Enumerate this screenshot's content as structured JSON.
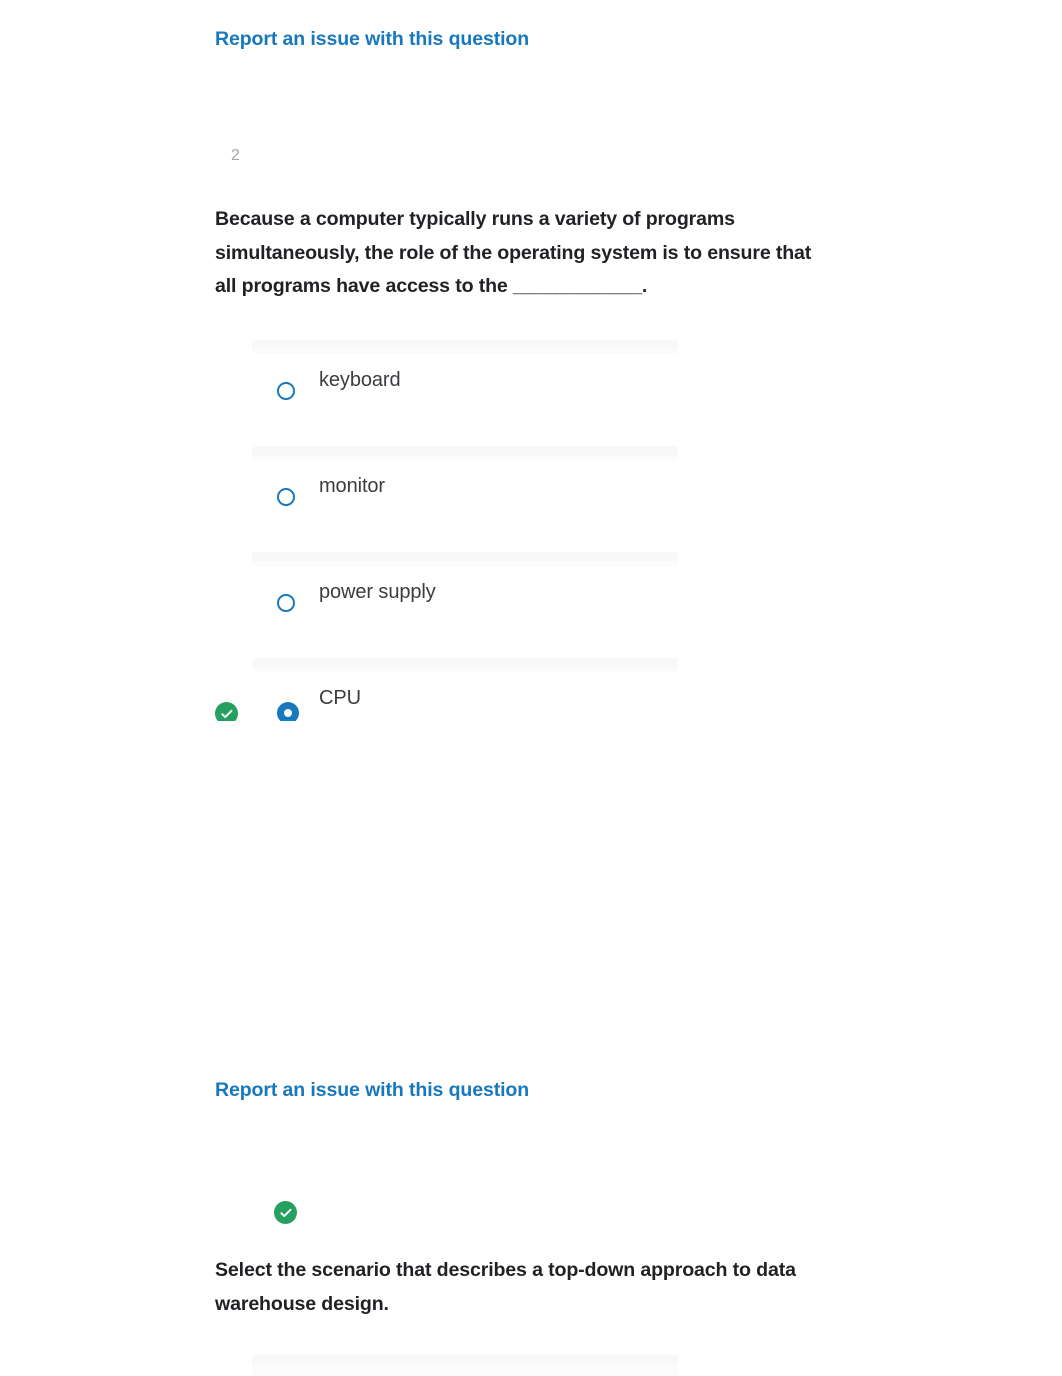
{
  "page": {
    "background_color": "#ffffff",
    "link_color": "#1878be",
    "correct_color": "#25a05e",
    "radio_color": "#1878be"
  },
  "report_links": [
    {
      "label": "Report an issue with this question"
    },
    {
      "label": "Report an issue with this question"
    }
  ],
  "question": {
    "number": "2",
    "text": "Because a computer typically runs a variety of programs simultaneously, the role of the operating system is to ensure that all programs have access to the ____________.",
    "options": [
      {
        "label": "keyboard",
        "selected": false,
        "correct": false
      },
      {
        "label": "monitor",
        "selected": false,
        "correct": false
      },
      {
        "label": "power supply",
        "selected": false,
        "correct": false
      },
      {
        "label": "CPU",
        "selected": true,
        "correct": true
      }
    ]
  },
  "next_question": {
    "status_icon": "check-circle-icon",
    "text": "Select the scenario that describes a top-down approach to data warehouse design."
  }
}
